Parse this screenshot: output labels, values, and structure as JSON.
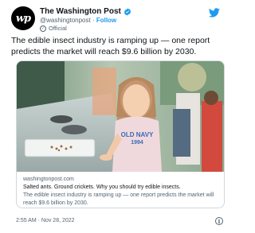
{
  "account": {
    "avatar_text": "wp",
    "name": "The Washington Post",
    "handle": "@washingtonpost",
    "separator": " · ",
    "follow_label": "Follow",
    "label": "Official"
  },
  "tweet": {
    "text": "The edible insect industry is ramping up — one report predicts the market will reach $9.6 billion by 2030.",
    "timestamp": "2:55 AM · Nov 28, 2022"
  },
  "card": {
    "domain": "washingtonpost.com",
    "title": "Salted ants. Ground crickets. Why you should try edible insects.",
    "description": "The edible insect industry is ramping up — one report predicts the market will reach $9.6 billion by 2030.",
    "shirt_text_1": "OLD NAVY",
    "shirt_text_2": "1994"
  },
  "colors": {
    "twitter_blue": "#1d9bf0",
    "text_primary": "#0f1419",
    "text_secondary": "#536471",
    "border": "#cfd9de"
  },
  "icons": {
    "verified": "verified-badge-icon",
    "twitter": "twitter-bird-icon",
    "official": "official-label-icon",
    "info": "info-icon"
  }
}
